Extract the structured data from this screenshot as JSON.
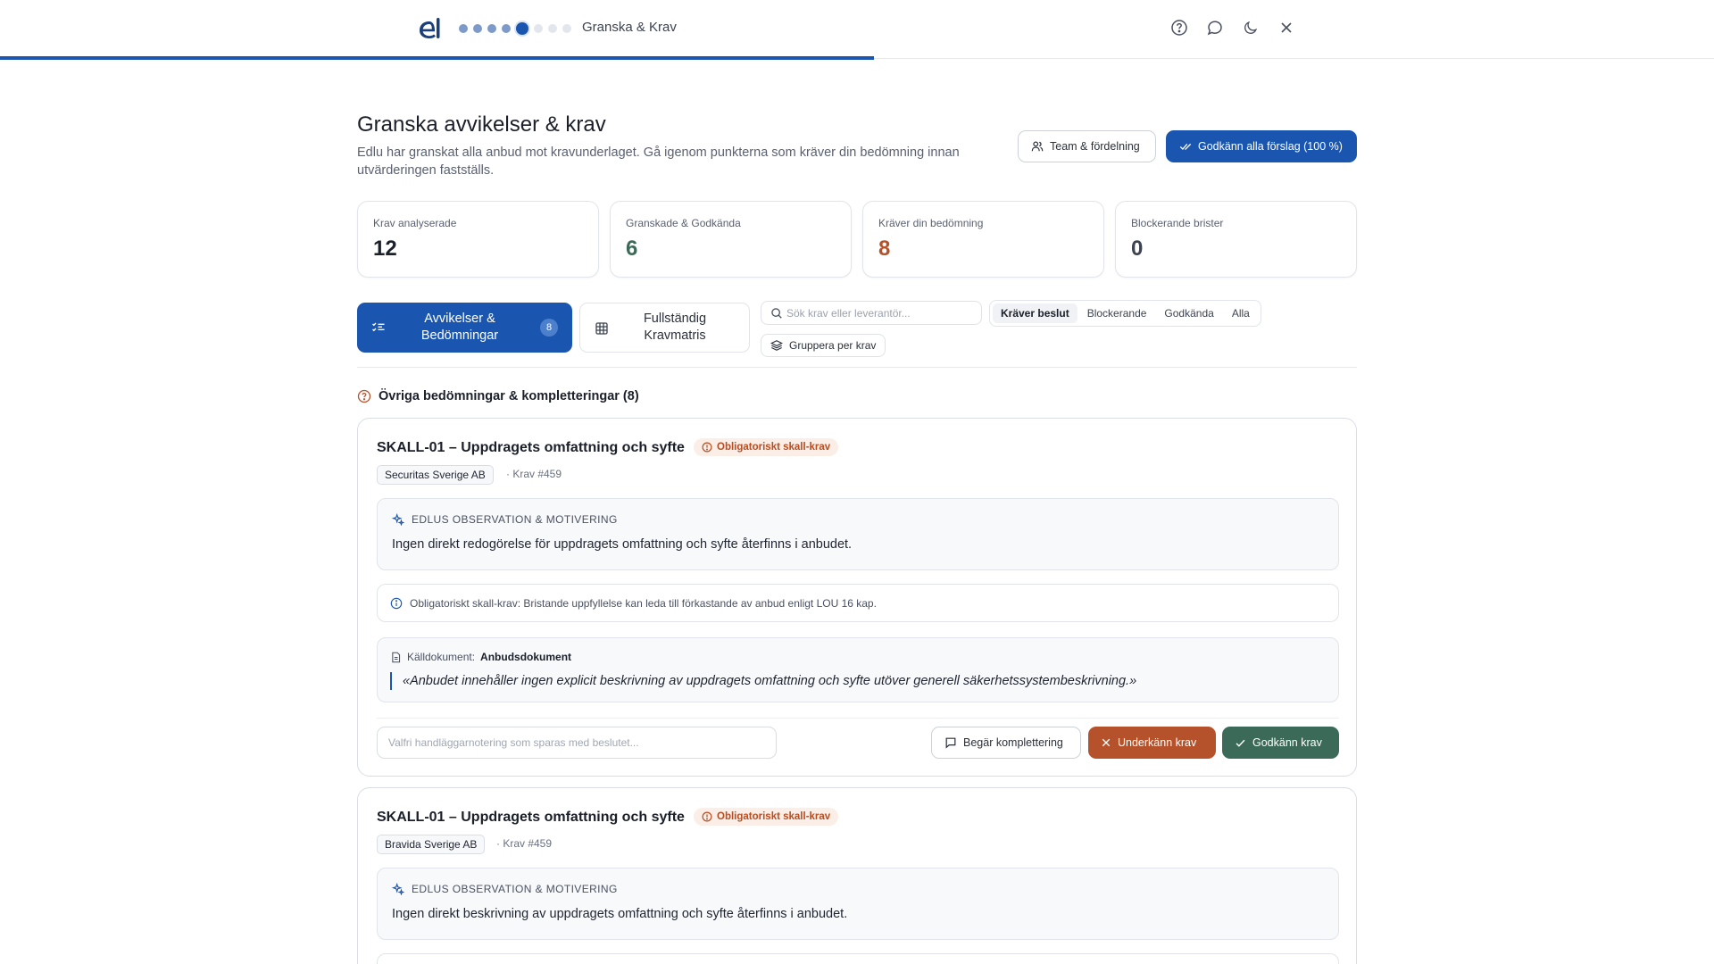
{
  "topbar": {
    "step_title": "Granska & Krav",
    "progress_fraction": 0.51,
    "steps": [
      "done",
      "done",
      "done",
      "done",
      "current",
      "todo",
      "todo",
      "todo"
    ],
    "icons": [
      "help-icon",
      "chat-icon",
      "moon-icon",
      "close-icon"
    ]
  },
  "header": {
    "title": "Granska avvikelser & krav",
    "subtitle": "Edlu har granskat alla anbud mot kravunderlaget. Gå igenom punkterna som kräver din bedömning innan utvärderingen fastställs.",
    "team_button": "Team & fördelning",
    "approve_all_button": "Godkänn alla förslag (100 %)"
  },
  "stats": [
    {
      "label": "Krav analyserade",
      "value": "12",
      "color": "#1b1f29"
    },
    {
      "label": "Granskade & Godkända",
      "value": "6",
      "color": "#3b6b58"
    },
    {
      "label": "Kräver din bedömning",
      "value": "8",
      "color": "#b5522b"
    },
    {
      "label": "Blockerande brister",
      "value": "0",
      "color": "#3d4350"
    }
  ],
  "tabs": {
    "deviations_label": "Avvikelser & Bedömningar",
    "deviations_count": "8",
    "matrix_label": "Fullständig Kravmatris"
  },
  "filters": {
    "search_placeholder": "Sök krav eller leverantör...",
    "segments": [
      "Kräver beslut",
      "Blockerande",
      "Godkända",
      "Alla"
    ],
    "active_segment": "Kräver beslut",
    "group_button": "Gruppera per krav"
  },
  "section": {
    "title": "Övriga bedömningar & kompletteringar (8)"
  },
  "cards": [
    {
      "title": "SKALL-01 – Uppdragets omfattning och syfte",
      "badge": "Obligatoriskt skall-krav",
      "vendor": "Securitas Sverige AB",
      "krav_ref": "· Krav #459",
      "obs_heading": "EDLUS OBSERVATION & MOTIVERING",
      "obs_text": "Ingen direkt redogörelse för uppdragets omfattning och syfte återfinns i anbudet.",
      "info_text": "Obligatoriskt skall-krav: Bristande uppfyllelse kan leda till förkastande av anbud enligt LOU 16 kap.",
      "source_label": "Källdokument:",
      "source_doc": "Anbudsdokument",
      "quote": "«Anbudet innehåller ingen explicit beskrivning av uppdragets omfattning och syfte utöver generell säkerhetssystembeskrivning.»",
      "note_placeholder": "Valfri handläggarnotering som sparas med beslutet...",
      "request_button": "Begär komplettering",
      "reject_button": "Underkänn krav",
      "approve_button": "Godkänn krav"
    },
    {
      "title": "SKALL-01 – Uppdragets omfattning och syfte",
      "badge": "Obligatoriskt skall-krav",
      "vendor": "Bravida Sverige AB",
      "krav_ref": "· Krav #459",
      "obs_heading": "EDLUS OBSERVATION & MOTIVERING",
      "obs_text": "Ingen direkt beskrivning av uppdragets omfattning och syfte återfinns i anbudet."
    }
  ]
}
